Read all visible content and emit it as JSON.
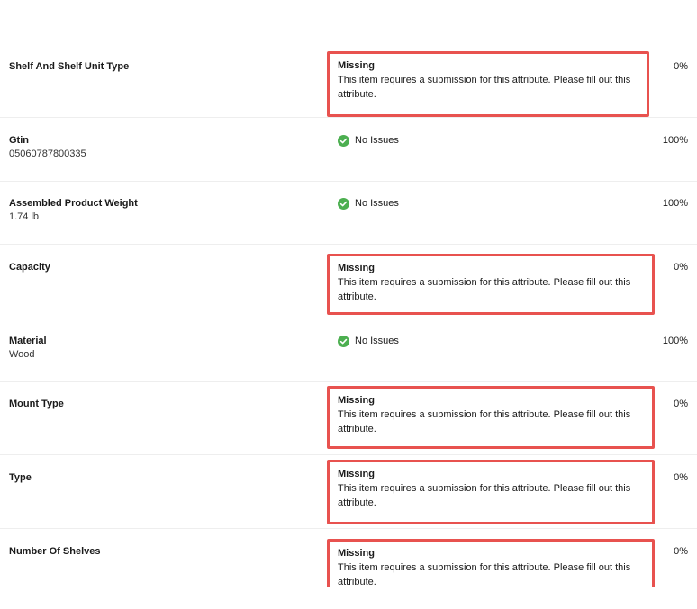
{
  "colors": {
    "highlight_border": "#e8524f",
    "check_green": "#4caf50",
    "divider": "#eeeeee"
  },
  "icons": {
    "ok": "check-circle-icon"
  },
  "rows": [
    {
      "name": "Shelf And Shelf Unit Type",
      "value": "",
      "status": "missing",
      "status_title": "Missing",
      "status_message": "This item requires a submission for this attribute. Please fill out this attribute.",
      "percent": "0%"
    },
    {
      "name": "Gtin",
      "value": "05060787800335",
      "status": "ok",
      "status_title": "No Issues",
      "status_message": "",
      "percent": "100%"
    },
    {
      "name": "Assembled Product Weight",
      "value": "1.74 lb",
      "status": "ok",
      "status_title": "No Issues",
      "status_message": "",
      "percent": "100%"
    },
    {
      "name": "Capacity",
      "value": "",
      "status": "missing",
      "status_title": "Missing",
      "status_message": "This item requires a submission for this attribute. Please fill out this attribute.",
      "percent": "0%"
    },
    {
      "name": "Material",
      "value": "Wood",
      "status": "ok",
      "status_title": "No Issues",
      "status_message": "",
      "percent": "100%"
    },
    {
      "name": "Mount Type",
      "value": "",
      "status": "missing",
      "status_title": "Missing",
      "status_message": "This item requires a submission for this attribute. Please fill out this attribute.",
      "percent": "0%"
    },
    {
      "name": "Type",
      "value": "",
      "status": "missing",
      "status_title": "Missing",
      "status_message": "This item requires a submission for this attribute. Please fill out this attribute.",
      "percent": "0%"
    },
    {
      "name": "Number Of Shelves",
      "value": "",
      "status": "missing",
      "status_title": "Missing",
      "status_message": "This item requires a submission for this attribute. Please fill out this attribute.",
      "percent": "0%"
    }
  ]
}
